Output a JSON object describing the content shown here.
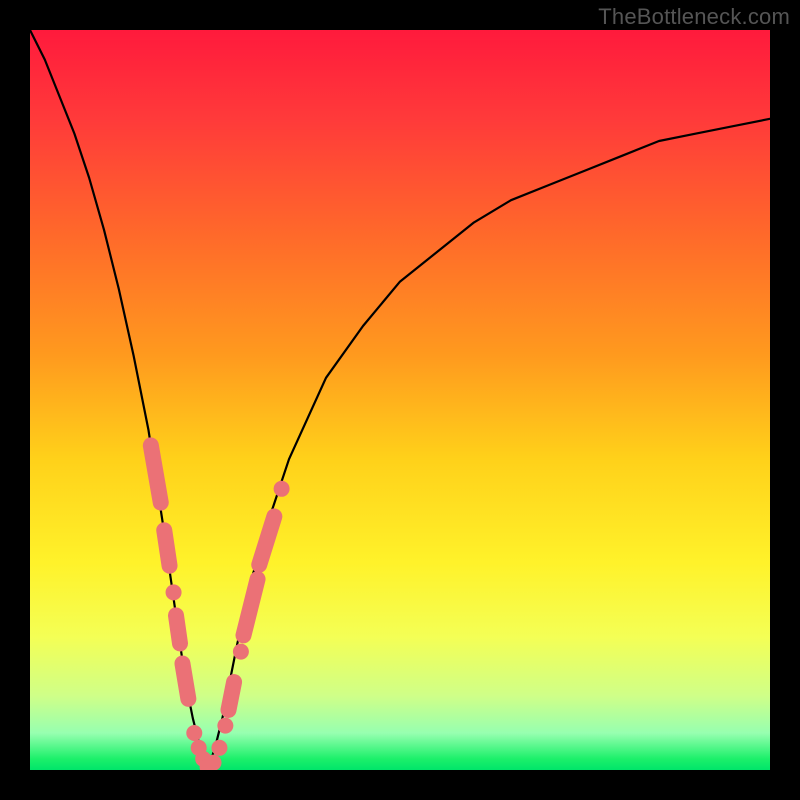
{
  "watermark": "TheBottleneck.com",
  "colors": {
    "frame": "#000000",
    "curve": "#000000",
    "marker": "#eb7176",
    "gradient_stops": [
      {
        "pos": 0.0,
        "color": "#ff1a3c"
      },
      {
        "pos": 0.12,
        "color": "#ff3a3a"
      },
      {
        "pos": 0.28,
        "color": "#ff6a2a"
      },
      {
        "pos": 0.44,
        "color": "#ff9a1e"
      },
      {
        "pos": 0.58,
        "color": "#ffd11a"
      },
      {
        "pos": 0.72,
        "color": "#fff22a"
      },
      {
        "pos": 0.82,
        "color": "#f4ff55"
      },
      {
        "pos": 0.9,
        "color": "#cfff88"
      },
      {
        "pos": 0.95,
        "color": "#97ffb0"
      },
      {
        "pos": 0.985,
        "color": "#1cf06a"
      },
      {
        "pos": 1.0,
        "color": "#00e56a"
      }
    ]
  },
  "chart_data": {
    "type": "line",
    "title": "",
    "xlabel": "",
    "ylabel": "",
    "xlim": [
      0,
      100
    ],
    "ylim": [
      0,
      100
    ],
    "x_vertex": 24,
    "series": [
      {
        "name": "curve",
        "x": [
          0,
          2,
          4,
          6,
          8,
          10,
          12,
          14,
          16,
          18,
          19,
          20,
          21,
          22,
          23,
          24,
          25,
          26,
          27,
          28,
          30,
          32,
          35,
          40,
          45,
          50,
          55,
          60,
          65,
          70,
          75,
          80,
          85,
          90,
          95,
          100
        ],
        "y": [
          100,
          96,
          91,
          86,
          80,
          73,
          65,
          56,
          46,
          33,
          26,
          19,
          12,
          7,
          3,
          0,
          3,
          7,
          12,
          17,
          26,
          33,
          42,
          53,
          60,
          66,
          70,
          74,
          77,
          79,
          81,
          83,
          85,
          86,
          87,
          88
        ]
      }
    ],
    "markers": [
      {
        "x": 17.0,
        "y": 40,
        "kind": "cap",
        "len": 10,
        "branch": "left"
      },
      {
        "x": 18.5,
        "y": 30,
        "kind": "cap",
        "len": 7,
        "branch": "left"
      },
      {
        "x": 19.4,
        "y": 24,
        "kind": "dot",
        "branch": "left"
      },
      {
        "x": 20.0,
        "y": 19,
        "kind": "cap",
        "len": 6,
        "branch": "left"
      },
      {
        "x": 21.0,
        "y": 12,
        "kind": "cap",
        "len": 7,
        "branch": "left"
      },
      {
        "x": 22.2,
        "y": 5,
        "kind": "dot",
        "branch": "left"
      },
      {
        "x": 22.8,
        "y": 3,
        "kind": "dot",
        "branch": "left"
      },
      {
        "x": 23.4,
        "y": 1.5,
        "kind": "dot",
        "branch": "left"
      },
      {
        "x": 24.0,
        "y": 0.4,
        "kind": "dot",
        "branch": "left"
      },
      {
        "x": 24.8,
        "y": 1.0,
        "kind": "dot",
        "branch": "right"
      },
      {
        "x": 25.6,
        "y": 3.0,
        "kind": "dot",
        "branch": "right"
      },
      {
        "x": 26.4,
        "y": 6.0,
        "kind": "dot",
        "branch": "right"
      },
      {
        "x": 27.2,
        "y": 10.0,
        "kind": "cap",
        "len": 6,
        "branch": "right"
      },
      {
        "x": 28.5,
        "y": 16.0,
        "kind": "dot",
        "branch": "right"
      },
      {
        "x": 29.8,
        "y": 22.0,
        "kind": "cap",
        "len": 10,
        "branch": "right"
      },
      {
        "x": 32.0,
        "y": 31.0,
        "kind": "cap",
        "len": 9,
        "branch": "right"
      },
      {
        "x": 34.0,
        "y": 38.0,
        "kind": "dot",
        "branch": "right"
      }
    ]
  }
}
